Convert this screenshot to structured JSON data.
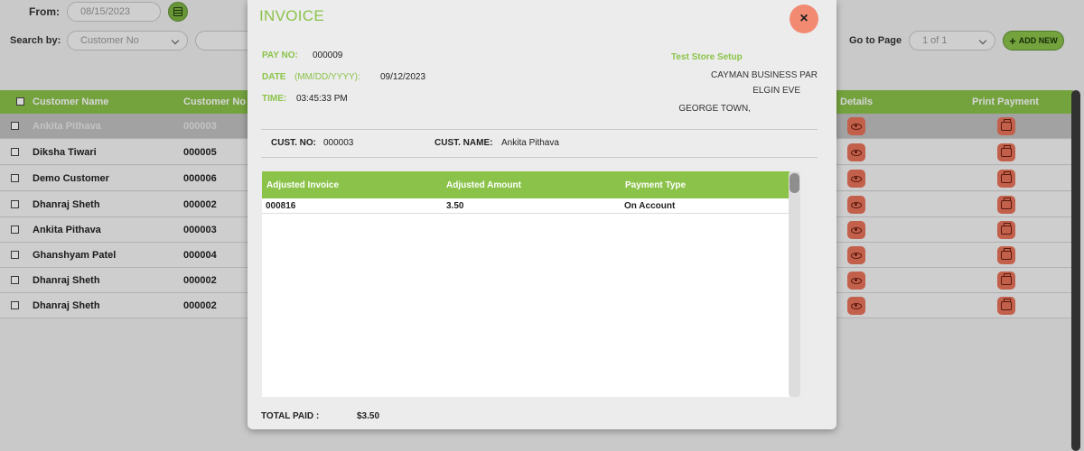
{
  "filters": {
    "from_label": "From:",
    "from_value": "08/15/2023",
    "search_by_label": "Search by:",
    "search_by_value": "Customer No",
    "go_to_page_label": "Go to Page",
    "page_value": "1 of 1",
    "add_new_label": "ADD NEW"
  },
  "table": {
    "columns": [
      "Customer Name",
      "Customer No",
      "Details",
      "Print Payment"
    ],
    "rows": [
      {
        "name": "Ankita Pithava",
        "no": "000003",
        "selected": true
      },
      {
        "name": "Diksha Tiwari",
        "no": "000005"
      },
      {
        "name": "Demo Customer",
        "no": "000006"
      },
      {
        "name": "Dhanraj Sheth",
        "no": "000002"
      },
      {
        "name": "Ankita Pithava",
        "no": "000003"
      },
      {
        "name": "Ghanshyam Patel",
        "no": "000004"
      },
      {
        "name": "Dhanraj Sheth",
        "no": "000002"
      },
      {
        "name": "Dhanraj Sheth",
        "no": "000002"
      }
    ]
  },
  "modal": {
    "title": "INVOICE",
    "close_symbol": "×",
    "pay_no_label": "PAY NO:",
    "pay_no": "000009",
    "date_label": "DATE",
    "date_format": "(MM/DD/YYYY):",
    "date": "09/12/2023",
    "time_label": "TIME:",
    "time": "03:45:33 PM",
    "store_name": "Test Store Setup",
    "address": [
      "CAYMAN BUSINESS PAR",
      "ELGIN EVE",
      "GEORGE TOWN,"
    ],
    "cust_no_label": "CUST. NO:",
    "cust_no": "000003",
    "cust_name_label": "CUST. NAME:",
    "cust_name": "Ankita Pithava",
    "columns": [
      "Adjusted Invoice",
      "Adjusted Amount",
      "Payment Type"
    ],
    "rows": [
      {
        "invoice": "000816",
        "amount": "3.50",
        "payment_type": "On Account"
      }
    ],
    "total_label": "TOTAL PAID :",
    "total_value": "$3.50"
  },
  "colors": {
    "accent_green": "#8bc34a",
    "close_orange": "#f28a72",
    "action_icon": "#e8735a"
  },
  "icons": {
    "calendar": "calendar-icon",
    "add": "plus-icon",
    "details": "eye-icon",
    "print": "printer-icon",
    "close": "close-icon"
  }
}
